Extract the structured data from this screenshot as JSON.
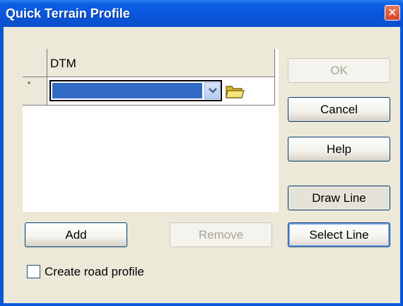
{
  "window": {
    "title": "Quick Terrain Profile",
    "close_glyph": "✕"
  },
  "grid": {
    "column_header": "DTM",
    "new_row_marker": "*",
    "row": {
      "value": ""
    }
  },
  "buttons": {
    "ok": "OK",
    "cancel": "Cancel",
    "help": "Help",
    "draw_line": "Draw Line",
    "select_line": "Select Line",
    "add": "Add",
    "remove": "Remove"
  },
  "checkbox": {
    "label": "Create road profile",
    "checked": false
  },
  "colors": {
    "titlebar": "#0a55d9",
    "dialog_bg": "#ece9d8",
    "selection": "#316ac5",
    "close": "#d4432a"
  },
  "icons": [
    "close-icon",
    "chevron-down-icon",
    "folder-icon"
  ]
}
